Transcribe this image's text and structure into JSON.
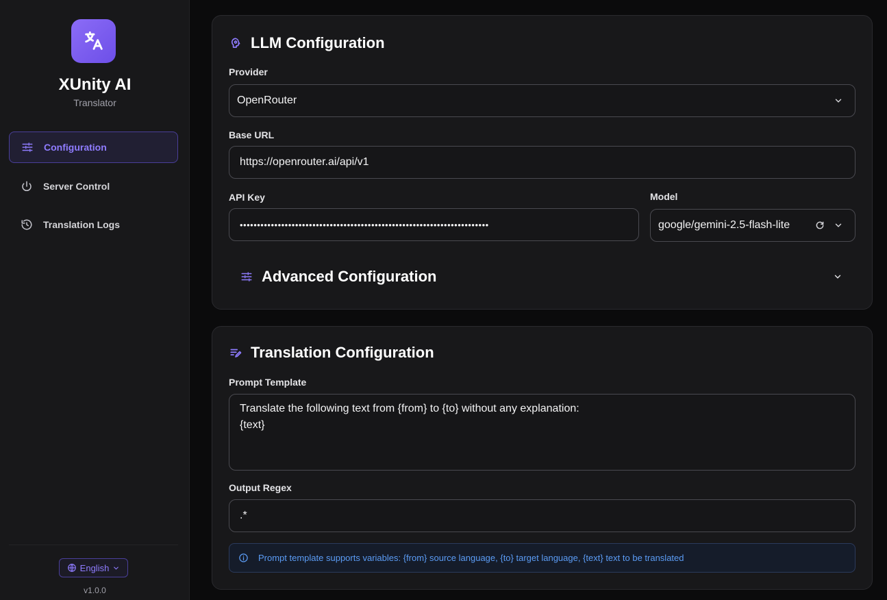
{
  "app": {
    "title": "XUnity AI",
    "subtitle": "Translator",
    "version": "v1.0.0"
  },
  "sidebar": {
    "items": [
      {
        "label": "Configuration",
        "icon": "sliders-icon",
        "active": true
      },
      {
        "label": "Server Control",
        "icon": "power-icon",
        "active": false
      },
      {
        "label": "Translation Logs",
        "icon": "history-icon",
        "active": false
      }
    ],
    "language": "English"
  },
  "llm": {
    "title": "LLM Configuration",
    "provider_label": "Provider",
    "provider_value": "OpenRouter",
    "base_url_label": "Base URL",
    "base_url_value": "https://openrouter.ai/api/v1",
    "api_key_label": "API Key",
    "api_key_value": "••••••••••••••••••••••••••••••••••••••••••••••••••••••••••••••••••••••••",
    "model_label": "Model",
    "model_value": "google/gemini-2.5-flash-lite",
    "advanced_title": "Advanced Configuration"
  },
  "translation": {
    "title": "Translation Configuration",
    "prompt_label": "Prompt Template",
    "prompt_value": "Translate the following text from {from} to {to} without any explanation:\n{text}",
    "regex_label": "Output Regex",
    "regex_value": ".*",
    "info_text": "Prompt template supports variables: {from} source language, {to} target language, {text} text to be translated"
  },
  "colors": {
    "accent": "#8f7cff",
    "info": "#5b9cf5",
    "background": "#0b0b0c",
    "card": "#18181a"
  }
}
